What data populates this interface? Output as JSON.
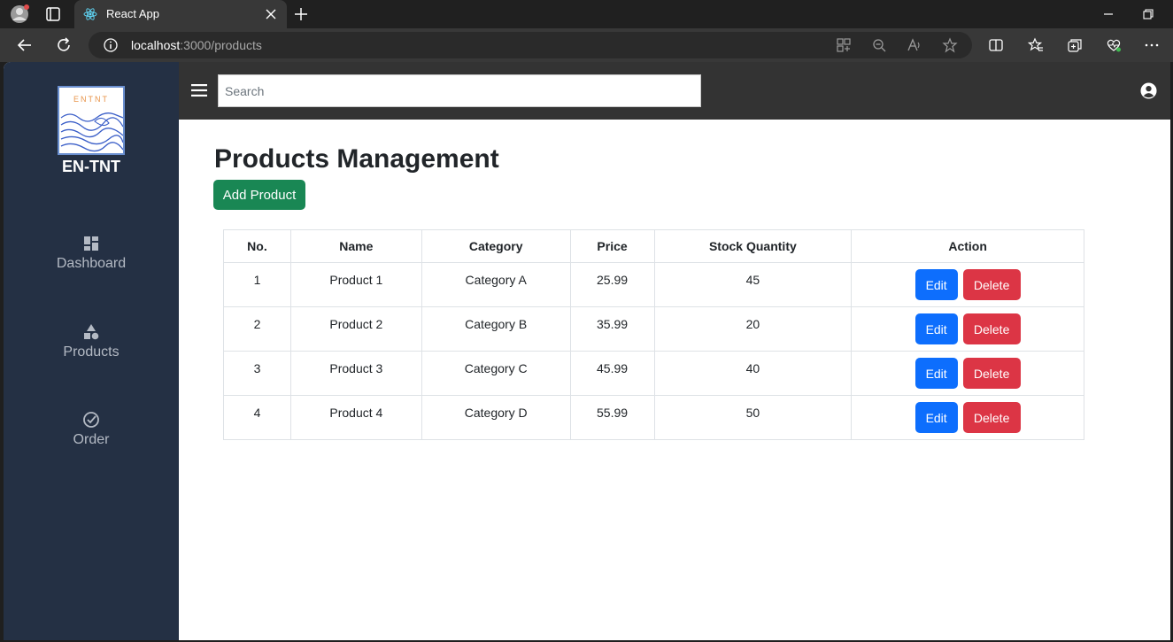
{
  "browser": {
    "tab_title": "React App",
    "url_host": "localhost",
    "url_path": ":3000/products",
    "icons": [
      "profile-icon",
      "tab-actions-icon",
      "react-favicon-icon",
      "close-tab-icon",
      "new-tab-icon",
      "minimize-icon",
      "restore-icon",
      "back-icon",
      "refresh-icon",
      "site-info-icon",
      "app-available-icon",
      "zoom-out-icon",
      "read-aloud-icon",
      "favorite-star-icon",
      "split-screen-icon",
      "favorites-icon",
      "collections-icon",
      "browser-essentials-icon",
      "more-menu-icon"
    ]
  },
  "sidebar": {
    "brand": "EN-TNT",
    "logo_text": "ENTNT",
    "items": [
      {
        "label": "Dashboard",
        "icon": "dashboard-grid-icon"
      },
      {
        "label": "Products",
        "icon": "shapes-icon"
      },
      {
        "label": "Order",
        "icon": "check-circle-icon"
      }
    ]
  },
  "topbar": {
    "search_placeholder": "Search"
  },
  "main": {
    "title": "Products Management",
    "add_button": "Add Product",
    "table": {
      "headers": [
        "No.",
        "Name",
        "Category",
        "Price",
        "Stock Quantity",
        "Action"
      ],
      "rows": [
        [
          "1",
          "Product 1",
          "Category A",
          "25.99",
          "45"
        ],
        [
          "2",
          "Product 2",
          "Category B",
          "35.99",
          "20"
        ],
        [
          "3",
          "Product 3",
          "Category C",
          "45.99",
          "40"
        ],
        [
          "4",
          "Product 4",
          "Category D",
          "55.99",
          "50"
        ]
      ],
      "edit_label": "Edit",
      "delete_label": "Delete"
    }
  },
  "colors": {
    "sidebar_bg": "#243044",
    "topbar_bg": "#333333",
    "add_green": "#198754",
    "edit_blue": "#0d6efd",
    "delete_red": "#dc3545"
  }
}
